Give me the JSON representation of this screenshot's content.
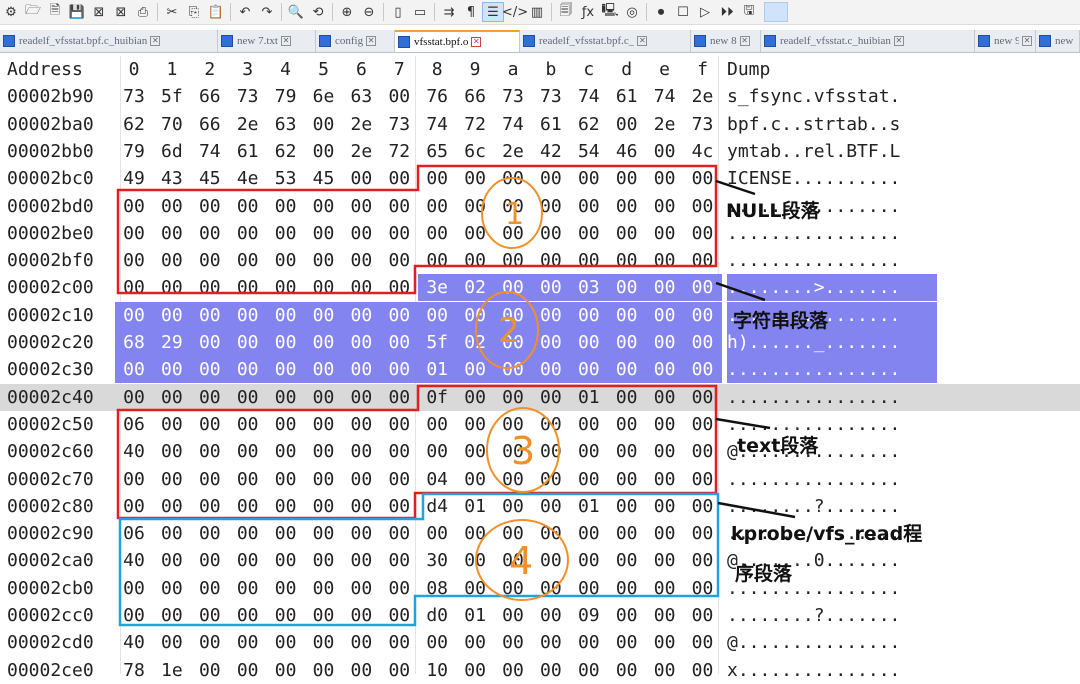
{
  "toolbar": {
    "icons": [
      "new-file-icon",
      "open-file-icon",
      "save-icon",
      "save-all-icon",
      "close-icon",
      "close-all-icon",
      "print-icon",
      "cut-icon",
      "copy-icon",
      "paste-icon",
      "undo-icon",
      "redo-icon",
      "find-icon",
      "replace-icon",
      "zoom-in-icon",
      "zoom-out-icon",
      "sync-vertical-icon",
      "sync-horizontal-icon",
      "word-wrap-icon",
      "show-all-chars-icon",
      "indent-guide-icon",
      "xml-tags-icon",
      "document-map-icon",
      "function-list-icon",
      "fx-icon",
      "monitor-icon",
      "settings-icon",
      "record-macro-icon",
      "stop-macro-icon",
      "play-macro-icon",
      "run-macro-icon",
      "save-macro-icon"
    ],
    "glyphs": [
      "⚙",
      "🗁",
      "🗎",
      "💾",
      "⊠",
      "⊠",
      "⎙",
      "✂",
      "⎘",
      "📋",
      "↶",
      "↷",
      "🔍",
      "⟲",
      "⊕",
      "⊖",
      "▯",
      "▭",
      "⇉",
      "¶",
      "☰",
      "</>",
      "▥",
      "🗐",
      "ƒx",
      "🖳",
      "◎",
      "⏺",
      "☐",
      "▷",
      "⏵⏵",
      "🖫"
    ]
  },
  "tabs": [
    {
      "label": "readelf_vfsstat.bpf.c_huibian",
      "active": false
    },
    {
      "label": "new 7.txt",
      "active": false
    },
    {
      "label": "config",
      "active": false
    },
    {
      "label": "vfsstat.bpf.o",
      "active": true
    },
    {
      "label": "readelf_vfsstat.bpf.c_",
      "active": false
    },
    {
      "label": "new 8",
      "active": false
    },
    {
      "label": "readelf_vfsstat.c_huibian",
      "active": false
    },
    {
      "label": "new 9",
      "active": false
    },
    {
      "label": "new",
      "active": false
    }
  ],
  "hex": {
    "address_header": "Address",
    "column_headers": [
      "0",
      "1",
      "2",
      "3",
      "4",
      "5",
      "6",
      "7",
      "8",
      "9",
      "a",
      "b",
      "c",
      "d",
      "e",
      "f"
    ],
    "dump_header": "Dump",
    "rows": [
      {
        "addr": "00002b90",
        "bytes": [
          "73",
          "5f",
          "66",
          "73",
          "79",
          "6e",
          "63",
          "00",
          "76",
          "66",
          "73",
          "73",
          "74",
          "61",
          "74",
          "2e"
        ],
        "dump": "s_fsync.vfsstat."
      },
      {
        "addr": "00002ba0",
        "bytes": [
          "62",
          "70",
          "66",
          "2e",
          "63",
          "00",
          "2e",
          "73",
          "74",
          "72",
          "74",
          "61",
          "62",
          "00",
          "2e",
          "73"
        ],
        "dump": "bpf.c..strtab..s"
      },
      {
        "addr": "00002bb0",
        "bytes": [
          "79",
          "6d",
          "74",
          "61",
          "62",
          "00",
          "2e",
          "72",
          "65",
          "6c",
          "2e",
          "42",
          "54",
          "46",
          "00",
          "4c"
        ],
        "dump": "ymtab..rel.BTF.L"
      },
      {
        "addr": "00002bc0",
        "bytes": [
          "49",
          "43",
          "45",
          "4e",
          "53",
          "45",
          "00",
          "00",
          "00",
          "00",
          "00",
          "00",
          "00",
          "00",
          "00",
          "00"
        ],
        "dump": "ICENSE.........."
      },
      {
        "addr": "00002bd0",
        "bytes": [
          "00",
          "00",
          "00",
          "00",
          "00",
          "00",
          "00",
          "00",
          "00",
          "00",
          "00",
          "00",
          "00",
          "00",
          "00",
          "00"
        ],
        "dump": "................"
      },
      {
        "addr": "00002be0",
        "bytes": [
          "00",
          "00",
          "00",
          "00",
          "00",
          "00",
          "00",
          "00",
          "00",
          "00",
          "00",
          "00",
          "00",
          "00",
          "00",
          "00"
        ],
        "dump": "................"
      },
      {
        "addr": "00002bf0",
        "bytes": [
          "00",
          "00",
          "00",
          "00",
          "00",
          "00",
          "00",
          "00",
          "00",
          "00",
          "00",
          "00",
          "00",
          "00",
          "00",
          "00"
        ],
        "dump": "................"
      },
      {
        "addr": "00002c00",
        "bytes": [
          "00",
          "00",
          "00",
          "00",
          "00",
          "00",
          "00",
          "00",
          "3e",
          "02",
          "00",
          "00",
          "03",
          "00",
          "00",
          "00"
        ],
        "dump": "........>......."
      },
      {
        "addr": "00002c10",
        "bytes": [
          "00",
          "00",
          "00",
          "00",
          "00",
          "00",
          "00",
          "00",
          "00",
          "00",
          "00",
          "00",
          "00",
          "00",
          "00",
          "00"
        ],
        "dump": "................"
      },
      {
        "addr": "00002c20",
        "bytes": [
          "68",
          "29",
          "00",
          "00",
          "00",
          "00",
          "00",
          "00",
          "5f",
          "02",
          "00",
          "00",
          "00",
          "00",
          "00",
          "00"
        ],
        "dump": "h)......_......."
      },
      {
        "addr": "00002c30",
        "bytes": [
          "00",
          "00",
          "00",
          "00",
          "00",
          "00",
          "00",
          "00",
          "01",
          "00",
          "00",
          "00",
          "00",
          "00",
          "00",
          "00"
        ],
        "dump": "................"
      },
      {
        "addr": "00002c40",
        "bytes": [
          "00",
          "00",
          "00",
          "00",
          "00",
          "00",
          "00",
          "00",
          "0f",
          "00",
          "00",
          "00",
          "01",
          "00",
          "00",
          "00"
        ],
        "dump": "................"
      },
      {
        "addr": "00002c50",
        "bytes": [
          "06",
          "00",
          "00",
          "00",
          "00",
          "00",
          "00",
          "00",
          "00",
          "00",
          "00",
          "00",
          "00",
          "00",
          "00",
          "00"
        ],
        "dump": "................"
      },
      {
        "addr": "00002c60",
        "bytes": [
          "40",
          "00",
          "00",
          "00",
          "00",
          "00",
          "00",
          "00",
          "00",
          "00",
          "00",
          "00",
          "00",
          "00",
          "00",
          "00"
        ],
        "dump": "@..............."
      },
      {
        "addr": "00002c70",
        "bytes": [
          "00",
          "00",
          "00",
          "00",
          "00",
          "00",
          "00",
          "00",
          "04",
          "00",
          "00",
          "00",
          "00",
          "00",
          "00",
          "00"
        ],
        "dump": "................"
      },
      {
        "addr": "00002c80",
        "bytes": [
          "00",
          "00",
          "00",
          "00",
          "00",
          "00",
          "00",
          "00",
          "d4",
          "01",
          "00",
          "00",
          "01",
          "00",
          "00",
          "00"
        ],
        "dump": "........?......."
      },
      {
        "addr": "00002c90",
        "bytes": [
          "06",
          "00",
          "00",
          "00",
          "00",
          "00",
          "00",
          "00",
          "00",
          "00",
          "00",
          "00",
          "00",
          "00",
          "00",
          "00"
        ],
        "dump": "................"
      },
      {
        "addr": "00002ca0",
        "bytes": [
          "40",
          "00",
          "00",
          "00",
          "00",
          "00",
          "00",
          "00",
          "30",
          "00",
          "00",
          "00",
          "00",
          "00",
          "00",
          "00"
        ],
        "dump": "@.......0......."
      },
      {
        "addr": "00002cb0",
        "bytes": [
          "00",
          "00",
          "00",
          "00",
          "00",
          "00",
          "00",
          "00",
          "08",
          "00",
          "00",
          "00",
          "00",
          "00",
          "00",
          "00"
        ],
        "dump": "................"
      },
      {
        "addr": "00002cc0",
        "bytes": [
          "00",
          "00",
          "00",
          "00",
          "00",
          "00",
          "00",
          "00",
          "d0",
          "01",
          "00",
          "00",
          "09",
          "00",
          "00",
          "00"
        ],
        "dump": "........?......."
      },
      {
        "addr": "00002cd0",
        "bytes": [
          "40",
          "00",
          "00",
          "00",
          "00",
          "00",
          "00",
          "00",
          "00",
          "00",
          "00",
          "00",
          "00",
          "00",
          "00",
          "00"
        ],
        "dump": "@..............."
      },
      {
        "addr": "00002ce0",
        "bytes": [
          "78",
          "1e",
          "00",
          "00",
          "00",
          "00",
          "00",
          "00",
          "10",
          "00",
          "00",
          "00",
          "00",
          "00",
          "00",
          "00"
        ],
        "dump": "x..............."
      }
    ]
  },
  "annotations": {
    "null_section": "NULL段落",
    "string_section": "字符串段落",
    "text_section": "text段落",
    "kprobe_section_line1": "kprobe/vfs_read程",
    "kprobe_section_line2": "序段落",
    "circle_1": "①",
    "circle_2": "②",
    "circle_3": "③",
    "circle_4": "④"
  },
  "colors": {
    "highlight": "#8484f0",
    "selected_row": "#d9d9d9",
    "red_box": "#e02020",
    "blue_box": "#1fa3e0",
    "orange_annotation": "#f0902a",
    "active_tab_accent": "#f0a030"
  }
}
